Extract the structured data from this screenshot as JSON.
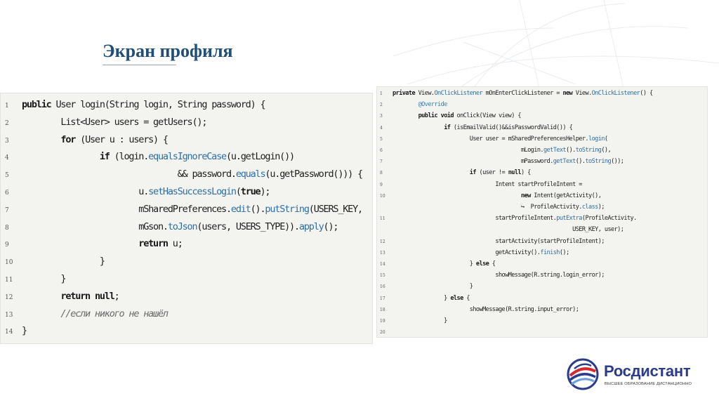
{
  "slide": {
    "title": "Экран профиля"
  },
  "code_left": {
    "lines": [
      {
        "n": "1",
        "t": "public User login(String login, String password) {"
      },
      {
        "n": "2",
        "t": "        List<User> users = getUsers();"
      },
      {
        "n": "3",
        "t": "        for (User u : users) {"
      },
      {
        "n": "4",
        "t": "                if (login.equalsIgnoreCase(u.getLogin())"
      },
      {
        "n": "5",
        "t": "                                && password.equals(u.getPassword())) {"
      },
      {
        "n": "6",
        "t": "                        u.setHasSuccessLogin(true);"
      },
      {
        "n": "7",
        "t": "                        mSharedPreferences.edit().putString(USERS_KEY,"
      },
      {
        "n": "8",
        "t": "                        mGson.toJson(users, USERS_TYPE)).apply();"
      },
      {
        "n": "9",
        "t": "                        return u;"
      },
      {
        "n": "10",
        "t": "                }"
      },
      {
        "n": "11",
        "t": "        }"
      },
      {
        "n": "12",
        "t": "        return null;"
      },
      {
        "n": "13",
        "t": "        //если никого не нашёл"
      },
      {
        "n": "14",
        "t": "}"
      }
    ]
  },
  "code_right": {
    "lines": [
      {
        "n": "1",
        "t": "private View.OnClickListener mOnEnterClickListener = new View.OnClickListener() {"
      },
      {
        "n": "2",
        "t": "        @Override"
      },
      {
        "n": "3",
        "t": "        public void onClick(View view) {"
      },
      {
        "n": "4",
        "t": "                if (isEmailValid()&&isPasswordValid()) {"
      },
      {
        "n": "5",
        "t": "                        User user = mSharedPreferencesHelper.login("
      },
      {
        "n": "6",
        "t": "                                        mLogin.getText().toString(),"
      },
      {
        "n": "7",
        "t": "                                        mPassword.getText().toString());"
      },
      {
        "n": "8",
        "t": "                        if (user != null) {"
      },
      {
        "n": "9",
        "t": "                                Intent startProfileIntent ="
      },
      {
        "n": "10",
        "t": "                                        new Intent(getActivity(),"
      },
      {
        "n": "",
        "t": "                                        ↪  ProfileActivity.class);"
      },
      {
        "n": "11",
        "t": "                                startProfileIntent.putExtra(ProfileActivity."
      },
      {
        "n": "",
        "t": "                                                        USER_KEY, user);"
      },
      {
        "n": "12",
        "t": "                                startActivity(startProfileIntent);"
      },
      {
        "n": "13",
        "t": "                                getActivity().finish();"
      },
      {
        "n": "14",
        "t": "                        } else {"
      },
      {
        "n": "15",
        "t": "                                showMessage(R.string.login_error);"
      },
      {
        "n": "16",
        "t": "                        }"
      },
      {
        "n": "17",
        "t": "                } else {"
      },
      {
        "n": "18",
        "t": "                        showMessage(R.string.input_error);"
      },
      {
        "n": "19",
        "t": "                }"
      },
      {
        "n": "20",
        "t": ""
      }
    ]
  },
  "logo": {
    "name": "Росдистант",
    "tagline": "ВЫСШЕЕ ОБРАЗОВАНИЕ ДИСТАНЦИОННО",
    "icon": "rosdistant-logo-icon"
  },
  "colors": {
    "title": "#1f4e79",
    "code_bg": "#f3f4f0",
    "keyword_blue": "#2e6ea3",
    "brand": "#2b3c8c",
    "brand_red": "#d8282f"
  }
}
